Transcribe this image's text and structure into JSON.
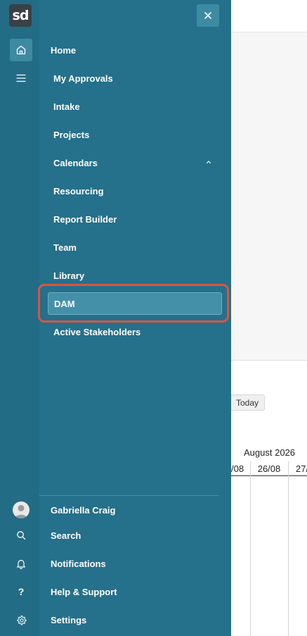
{
  "app": {
    "logo_text": "sd"
  },
  "background": {
    "today_label": "Today",
    "month_label": "August 2026",
    "days": [
      "/08",
      "26/08",
      "27/"
    ]
  },
  "nav": {
    "items": [
      {
        "label": "Home",
        "active": false
      },
      {
        "label": "My Approvals",
        "active": false
      },
      {
        "label": "Intake",
        "active": false
      },
      {
        "label": "Projects",
        "active": false
      },
      {
        "label": "Calendars",
        "active": false,
        "expanded": true
      },
      {
        "label": "Resourcing",
        "active": false
      },
      {
        "label": "Report Builder",
        "active": false
      },
      {
        "label": "Team",
        "active": false
      },
      {
        "label": "Library",
        "active": false
      },
      {
        "label": "DAM",
        "active": true
      },
      {
        "label": "Active Stakeholders",
        "active": false
      }
    ]
  },
  "footer": {
    "user_name": "Gabriella Craig",
    "search_label": "Search",
    "notifications_label": "Notifications",
    "help_label": "Help & Support",
    "help_icon_text": "?",
    "settings_label": "Settings"
  },
  "colors": {
    "drawer": "#25708b",
    "active_item": "#4490a8",
    "highlight_border": "#d9553f"
  }
}
